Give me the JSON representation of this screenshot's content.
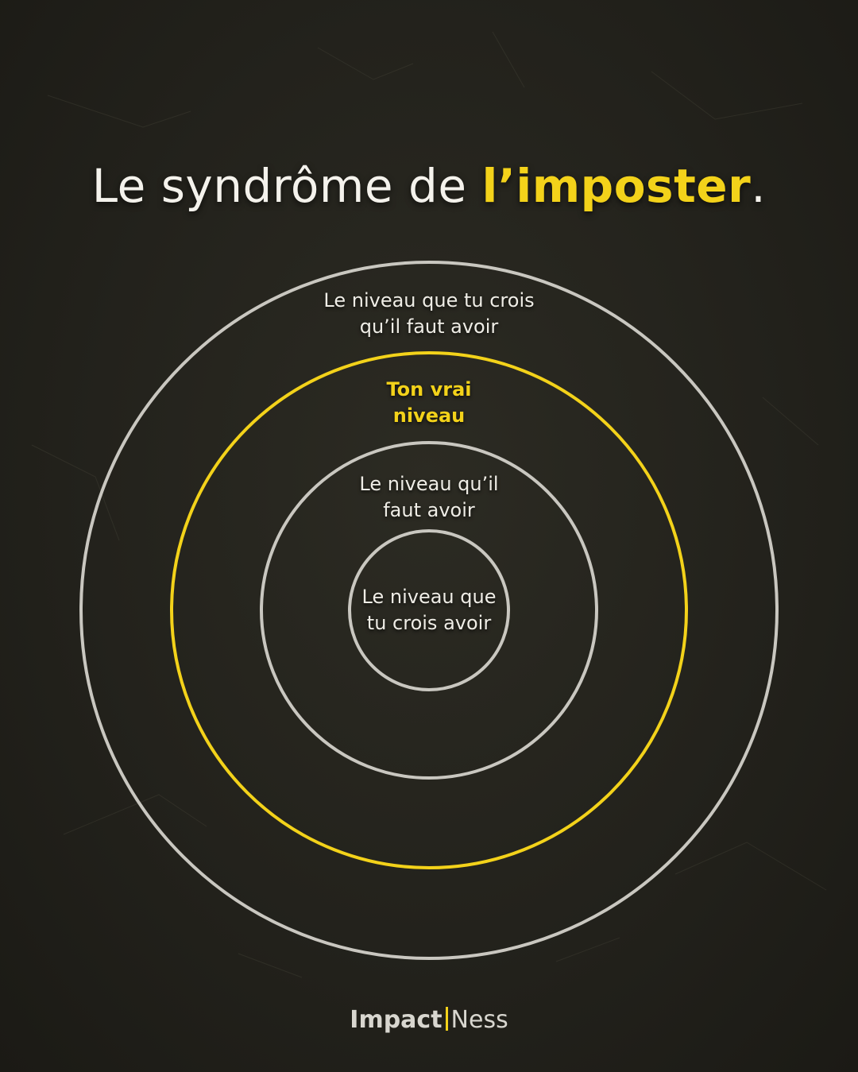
{
  "title": {
    "prefix": "Le syndrôme de ",
    "highlight": "l’imposter",
    "suffix": "."
  },
  "rings": [
    {
      "label_line1": "Le niveau que tu crois",
      "label_line2": "qu’il faut avoir",
      "color": "#c9c7c0"
    },
    {
      "label_line1": "Ton vrai",
      "label_line2": "niveau",
      "color": "#f3d21a"
    },
    {
      "label_line1": "Le niveau qu’il",
      "label_line2": "faut avoir",
      "color": "#c9c7c0"
    },
    {
      "label_line1": "Le niveau que",
      "label_line2": "tu crois avoir",
      "color": "#c9c7c0"
    }
  ],
  "logo": {
    "part1": "Impact",
    "part2": "Ness"
  },
  "colors": {
    "background": "#24231d",
    "accent": "#f3d21a",
    "ring": "#c9c7c0",
    "text": "#efede6"
  }
}
